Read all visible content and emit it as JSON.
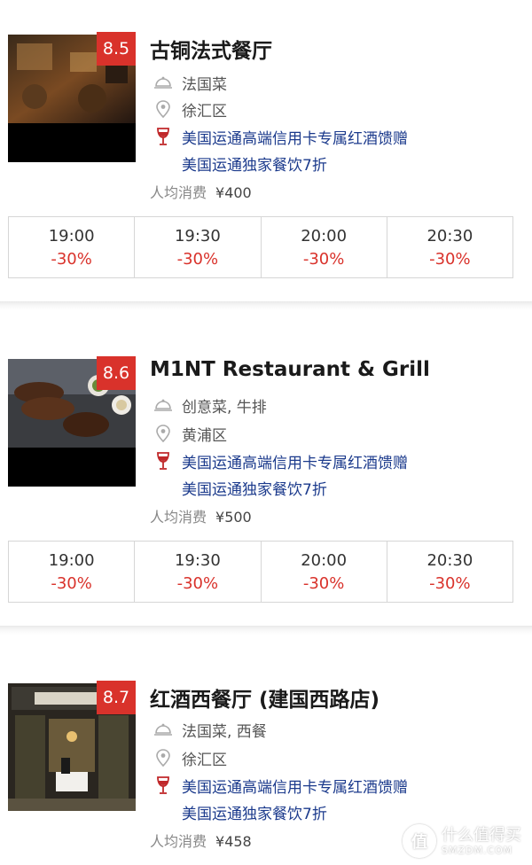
{
  "restaurants": [
    {
      "name": "古铜法式餐厅",
      "score": "8.5",
      "cuisine": "法国菜",
      "district": "徐汇区",
      "promo_line1": "美国运通高端信用卡专属红酒馈赠",
      "promo_line2": "美国运通独家餐饮7折",
      "price_label": "人均消费",
      "price_value": "¥400",
      "slots": [
        {
          "time": "19:00",
          "discount": "-30%"
        },
        {
          "time": "19:30",
          "discount": "-30%"
        },
        {
          "time": "20:00",
          "discount": "-30%"
        },
        {
          "time": "20:30",
          "discount": "-30%"
        }
      ]
    },
    {
      "name": "M1NT Restaurant & Grill",
      "score": "8.6",
      "cuisine": "创意菜, 牛排",
      "district": "黄浦区",
      "promo_line1": "美国运通高端信用卡专属红酒馈赠",
      "promo_line2": "美国运通独家餐饮7折",
      "price_label": "人均消费",
      "price_value": "¥500",
      "slots": [
        {
          "time": "19:00",
          "discount": "-30%"
        },
        {
          "time": "19:30",
          "discount": "-30%"
        },
        {
          "time": "20:00",
          "discount": "-30%"
        },
        {
          "time": "20:30",
          "discount": "-30%"
        }
      ]
    },
    {
      "name": "红酒西餐厅 (建国西路店)",
      "score": "8.7",
      "cuisine": "法国菜, 西餐",
      "district": "徐汇区",
      "promo_line1": "美国运通高端信用卡专属红酒馈赠",
      "promo_line2": "美国运通独家餐饮7折",
      "price_label": "人均消费",
      "price_value": "¥458"
    }
  ],
  "watermark": {
    "icon_text": "值",
    "line1": "什么值得买",
    "line2": "SMZDM.COM"
  },
  "colors": {
    "score_bg": "#d9322b",
    "promo_text": "#1b3a8c",
    "discount": "#d9322b"
  },
  "icons": [
    "cloche-icon",
    "location-pin-icon",
    "wine-glass-icon"
  ]
}
